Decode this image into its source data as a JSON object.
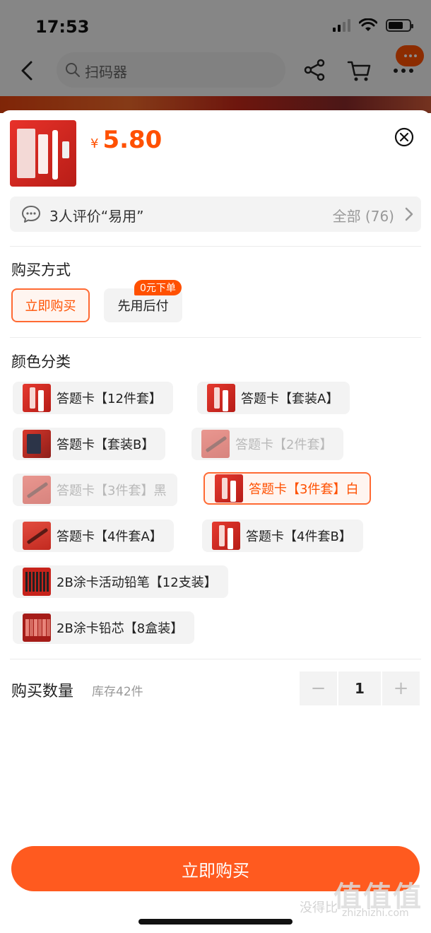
{
  "status_bar": {
    "time": "17:53"
  },
  "nav": {
    "search_placeholder": "扫码器"
  },
  "product": {
    "currency": "¥",
    "price": "5.80"
  },
  "review": {
    "text": "3人评价“易用”",
    "all_label": "全部 (76)"
  },
  "purchase_method": {
    "title": "购买方式",
    "options": [
      {
        "label": "立即购买",
        "selected": true
      },
      {
        "label": "先用后付",
        "selected": false
      }
    ],
    "promo_tag": "0元下单"
  },
  "color": {
    "title": "颜色分类",
    "options": [
      {
        "label": "答题卡【12件套】",
        "state": "normal",
        "image": "red-kit"
      },
      {
        "label": "答题卡【套装A】",
        "state": "normal",
        "image": "red-kit"
      },
      {
        "label": "答题卡【套装B】",
        "state": "normal",
        "image": "calculator-kit"
      },
      {
        "label": "答题卡【2件套】",
        "state": "disabled",
        "image": "pencil"
      },
      {
        "label": "答题卡【3件套】黑",
        "state": "disabled",
        "image": "pencil"
      },
      {
        "label": "答题卡【3件套】白",
        "state": "selected",
        "image": "red-kit"
      },
      {
        "label": "答题卡【4件套A】",
        "state": "normal",
        "image": "pencil"
      },
      {
        "label": "答题卡【4件套B】",
        "state": "normal",
        "image": "red-kit"
      },
      {
        "label": "2B涂卡活动铅笔【12支装】",
        "state": "normal",
        "image": "pencil-rack"
      },
      {
        "label": "2B涂卡铅芯【8盒装】",
        "state": "normal",
        "image": "lead-boxes"
      }
    ]
  },
  "quantity": {
    "title": "购买数量",
    "stock": "库存42件",
    "value": "1",
    "minus": "−",
    "plus": "+"
  },
  "buy_button": {
    "label": "立即购买"
  },
  "watermark": {
    "big": "值值值",
    "small1": "没得比",
    "small2": "zhizhizhi.com"
  },
  "colors": {
    "accent": "#ff5000",
    "button": "#ff5a1f",
    "selected_bg": "#fff5f0"
  }
}
